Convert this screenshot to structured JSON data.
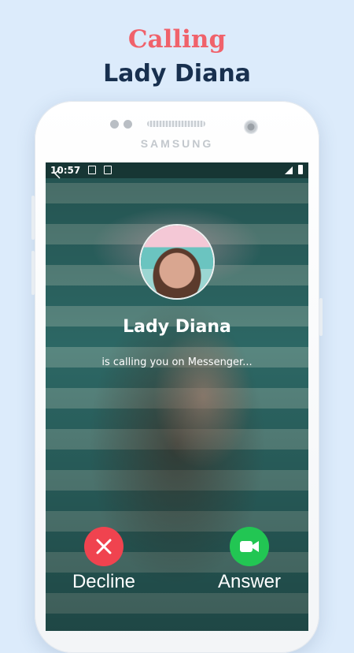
{
  "promo": {
    "line1": "Calling",
    "line2": "Lady Diana"
  },
  "device": {
    "brand": "SAMSUNG"
  },
  "status_bar": {
    "time": "10:57",
    "icons": [
      "image-icon",
      "a-icon",
      "signal-icon",
      "battery-icon"
    ]
  },
  "call": {
    "caller_name": "Lady Diana",
    "subtitle": "is calling you on Messenger...",
    "decline_label": "Decline",
    "answer_label": "Answer"
  },
  "colors": {
    "accent_red": "#f0626b",
    "title_navy": "#18304f",
    "decline": "#f0434f",
    "answer": "#22c653",
    "background": "#dcebfb"
  }
}
